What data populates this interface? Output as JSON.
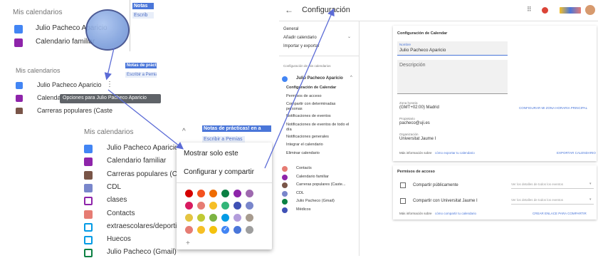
{
  "top_left": {
    "header": "Mis calendarios",
    "items": [
      {
        "label": "Julio Pacheco Aparicio",
        "color": "#4285f4"
      },
      {
        "label": "Calendario familiar",
        "color": "#8e24aa"
      }
    ],
    "chip1": "Notas",
    "chip2": "Escrib"
  },
  "mid_left": {
    "header": "Mis calendarios",
    "items": [
      {
        "label": "Julio Pacheco Aparicio",
        "color": "#4285f4"
      },
      {
        "label": "Calendario",
        "color": "#8e24aa"
      },
      {
        "label": "Carreras populares (Caste",
        "color": "#795548"
      }
    ],
    "tooltip": "Opciones para Julio Pacheco Aparicio",
    "chip1": "Notas de práctic",
    "chip2": "Escribir a Pemias"
  },
  "list": {
    "header": "Mis calendarios",
    "items": [
      {
        "label": "Julio Pacheco Aparicio",
        "color": "#4285f4",
        "checked": true
      },
      {
        "label": "Calendario familiar",
        "color": "#8e24aa",
        "checked": true
      },
      {
        "label": "Carreras populares (Cas",
        "color": "#795548",
        "checked": true
      },
      {
        "label": "CDL",
        "color": "#7986cb",
        "checked": true
      },
      {
        "label": "clases",
        "color": "#8e24aa",
        "checked": false
      },
      {
        "label": "Contacts",
        "color": "#e67c73",
        "checked": true
      },
      {
        "label": "extraescolares/deporti",
        "color": "#039be5",
        "checked": false
      },
      {
        "label": "Huecos",
        "color": "#039be5",
        "checked": false
      },
      {
        "label": "Julio Pacheco (Gmail)",
        "color": "#0b8043",
        "checked": false
      }
    ],
    "chip1": "Notas de prácticas! en a",
    "chip2": "Escribir a Pemias"
  },
  "menu": {
    "item1": "Mostrar solo este",
    "item2": "Configurar y compartir",
    "add": "+",
    "palette": [
      "#d50000",
      "#f4511e",
      "#ef6c00",
      "#0b8043",
      "#8e24aa",
      "#9e69af",
      "#d81b60",
      "#e67c73",
      "#f6bf26",
      "#33b679",
      "#3f51b5",
      "#7986cb",
      "#e4c441",
      "#c0ca33",
      "#7cb342",
      "#039be5",
      "#b39ddb",
      "#a79b8e",
      "#e67c73",
      "#f6bf26",
      "#f4c20d",
      "#4285f4",
      "#4a76d9",
      "#9e9e9e"
    ]
  },
  "settings": {
    "back_icon": "back-arrow-icon",
    "title": "Configuración",
    "nav": {
      "general": "General",
      "add_calendar": "Añadir calendario",
      "import_export": "Importar y exportar",
      "section": "Configuración de mis calendarios",
      "selected_calendar": "Julio Pacheco Aparicio",
      "sub": [
        "Configuración de Calendar",
        "Permisos de acceso",
        "Compartir con determinadas personas",
        "Notificaciones de eventos",
        "Notificaciones de eventos de todo el día",
        "Notificaciones generales",
        "Integrar el calendario",
        "Eliminar calendario"
      ],
      "calendars": [
        {
          "label": "Contacts",
          "color": "#e67c73"
        },
        {
          "label": "Calendario familiar",
          "color": "#8e24aa"
        },
        {
          "label": "Carreras populares (Caste...",
          "color": "#795548"
        },
        {
          "label": "CDL",
          "color": "#7986cb"
        },
        {
          "label": "Julio Pacheco (Gmail)",
          "color": "#0b8043"
        },
        {
          "label": "Médicos",
          "color": "#3f51b5"
        }
      ]
    },
    "card1": {
      "title": "Configuración de Calendar",
      "name_label": "Nombre",
      "name_value": "Julio Pacheco Aparicio",
      "desc_placeholder": "Descripción",
      "tz_label": "Zona horaria",
      "tz_value": "(GMT+02:00) Madrid",
      "tz_link": "CONFIGURAR MI ZONA HORARIA PRINCIPAL",
      "owner_label": "Propietario",
      "owner_value": "pacheco@uji.es",
      "org_label": "Organización",
      "org_value": "Universitat Jaume I",
      "info_text": "Más información sobre",
      "info_link": "cómo exportar tu calendario",
      "export": "EXPORTAR CALENDARIO"
    },
    "card2": {
      "title": "Permisos de acceso",
      "public": "Compartir públicamente",
      "org": "Compartir con Universitat Jaume I",
      "select1": "Ver los detalles de todos los eventos",
      "select2": "Ver los detalles de todos los eventos",
      "info_text": "Más información sobre",
      "info_link": "cómo compartir tu calendario",
      "link_btn": "CREAR ENLACE PARA COMPARTIR"
    },
    "accent": "#4a76d9"
  }
}
